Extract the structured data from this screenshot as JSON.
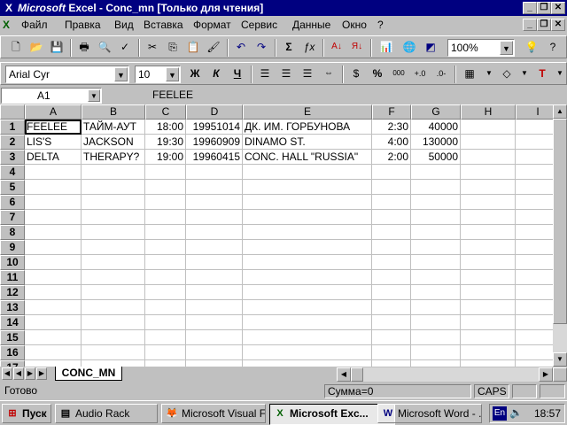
{
  "window": {
    "app_name": "Microsoft Excel - Conc_mn  [Только для чтения]",
    "app_prefix": "Microsoft",
    "app_rest": " Excel - Conc_mn  [Только для чтения]"
  },
  "menu": [
    "Файл",
    "Правка",
    "Вид",
    "Вставка",
    "Формат",
    "Сервис",
    "Данные",
    "Окно",
    "?"
  ],
  "toolbar": {
    "zoom": "100%"
  },
  "format": {
    "font_name": "Arial Cyr",
    "font_size": "10",
    "bold": "Ж",
    "italic": "К",
    "underline": "Ч",
    "percent": "%",
    "thousands": "000"
  },
  "formula": {
    "name_box": "A1",
    "value": "FEELEE"
  },
  "grid": {
    "columns": [
      "A",
      "B",
      "C",
      "D",
      "E",
      "F",
      "G",
      "H",
      "I"
    ],
    "rows": [
      "1",
      "2",
      "3",
      "4",
      "5",
      "6",
      "7",
      "8",
      "9",
      "10",
      "11",
      "12",
      "13",
      "14",
      "15",
      "16",
      "17"
    ],
    "data": [
      [
        "FEELEE",
        "ТАЙМ-АУТ",
        "18:00",
        "19951014",
        "ДК.  ИМ. ГОРБУНОВА",
        "2:30",
        "40000"
      ],
      [
        "LIS'S",
        "JACKSON",
        "19:30",
        "19960909",
        "DINAMO ST.",
        "4:00",
        "130000"
      ],
      [
        "DELTA",
        "THERAPY?",
        "19:00",
        "19960415",
        "CONC. HALL \"RUSSIA\"",
        "2:00",
        "50000"
      ]
    ]
  },
  "sheet": {
    "tab": "CONC_MN"
  },
  "status": {
    "ready": "Готово",
    "sum": "Сумма=0",
    "caps": "CAPS"
  },
  "taskbar": {
    "start": "Пуск",
    "tasks": [
      "Audio Rack",
      "Microsoft Visual F...",
      "Microsoft Exc...",
      "Microsoft Word - ..."
    ],
    "lang": "En",
    "clock": "18:57"
  }
}
